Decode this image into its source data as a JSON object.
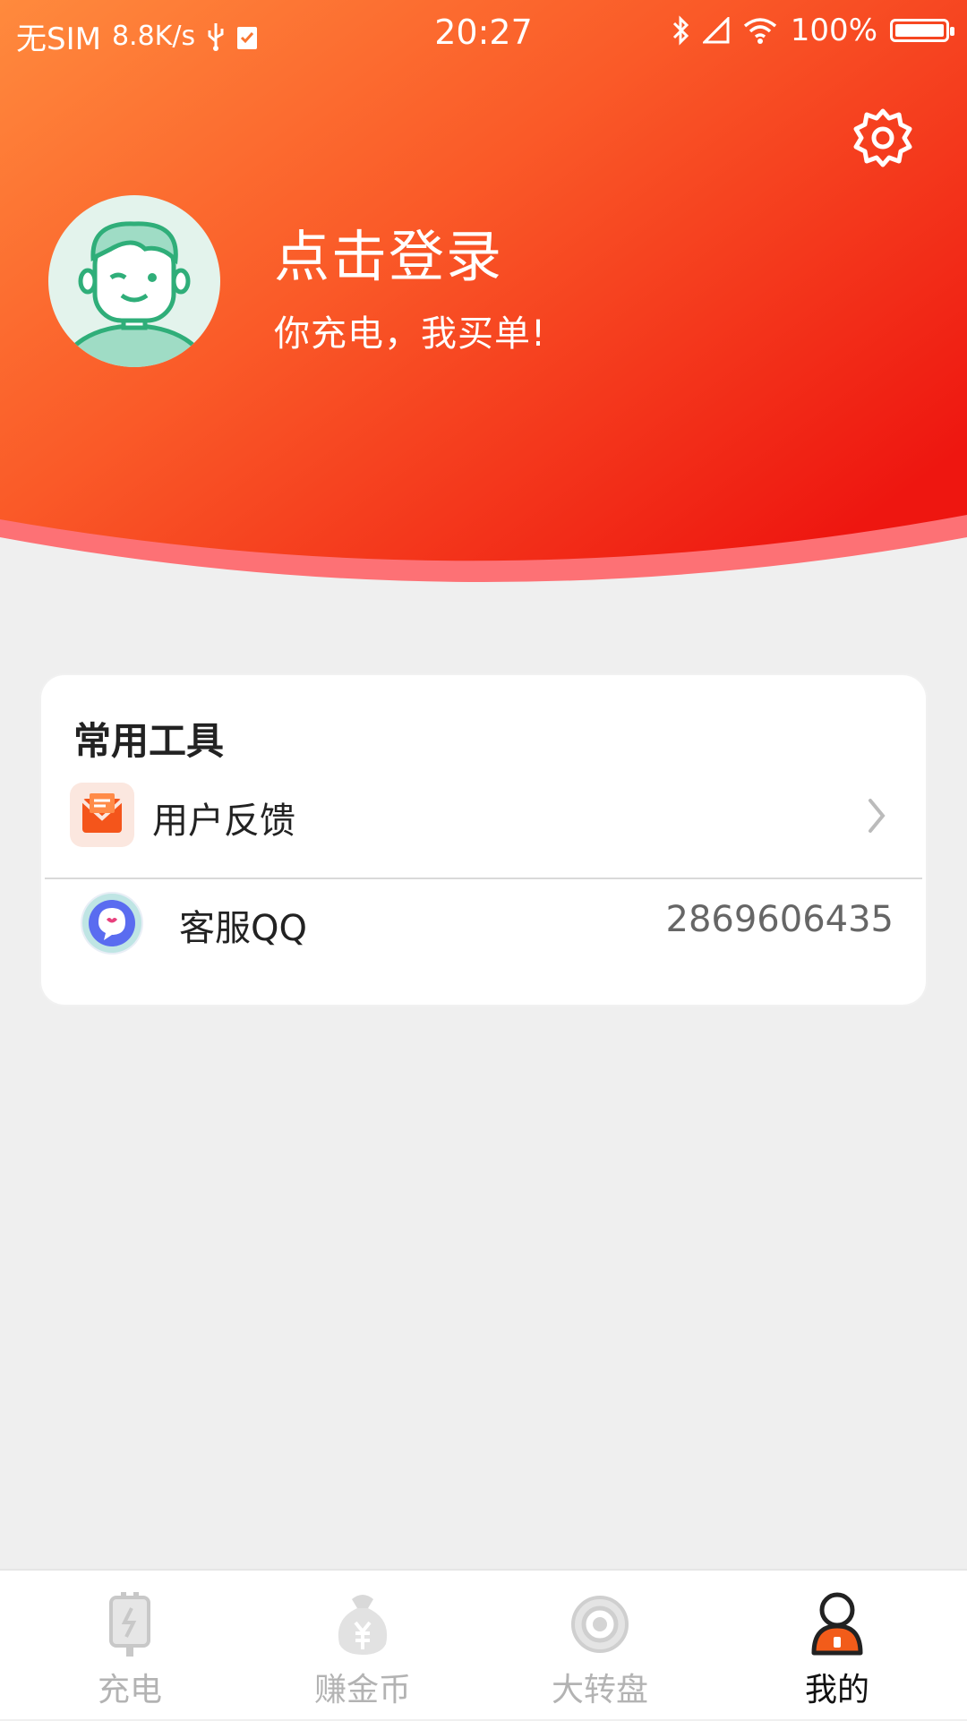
{
  "status_bar": {
    "carrier": "无SIM",
    "speed": "8.8K/s",
    "time": "20:27",
    "battery_percent": "100%",
    "battery_level": 1.0
  },
  "header": {
    "login_title": "点击登录",
    "login_subtitle": "你充电，我买单!"
  },
  "tools": {
    "title": "常用工具",
    "feedback_label": "用户反馈",
    "qq_label": "客服QQ",
    "qq_number": "2869606435"
  },
  "tabbar": {
    "tabs": [
      {
        "label": "充电",
        "icon": "charging-station-icon"
      },
      {
        "label": "赚金币",
        "icon": "money-bag-icon"
      },
      {
        "label": "大转盘",
        "icon": "wheel-icon"
      },
      {
        "label": "我的",
        "icon": "user-icon"
      }
    ],
    "active_index": 3
  },
  "colors": {
    "header_start": "#ff7a3c",
    "header_end": "#ee1c12",
    "accent": "#f25c1a",
    "background": "#efefef"
  }
}
